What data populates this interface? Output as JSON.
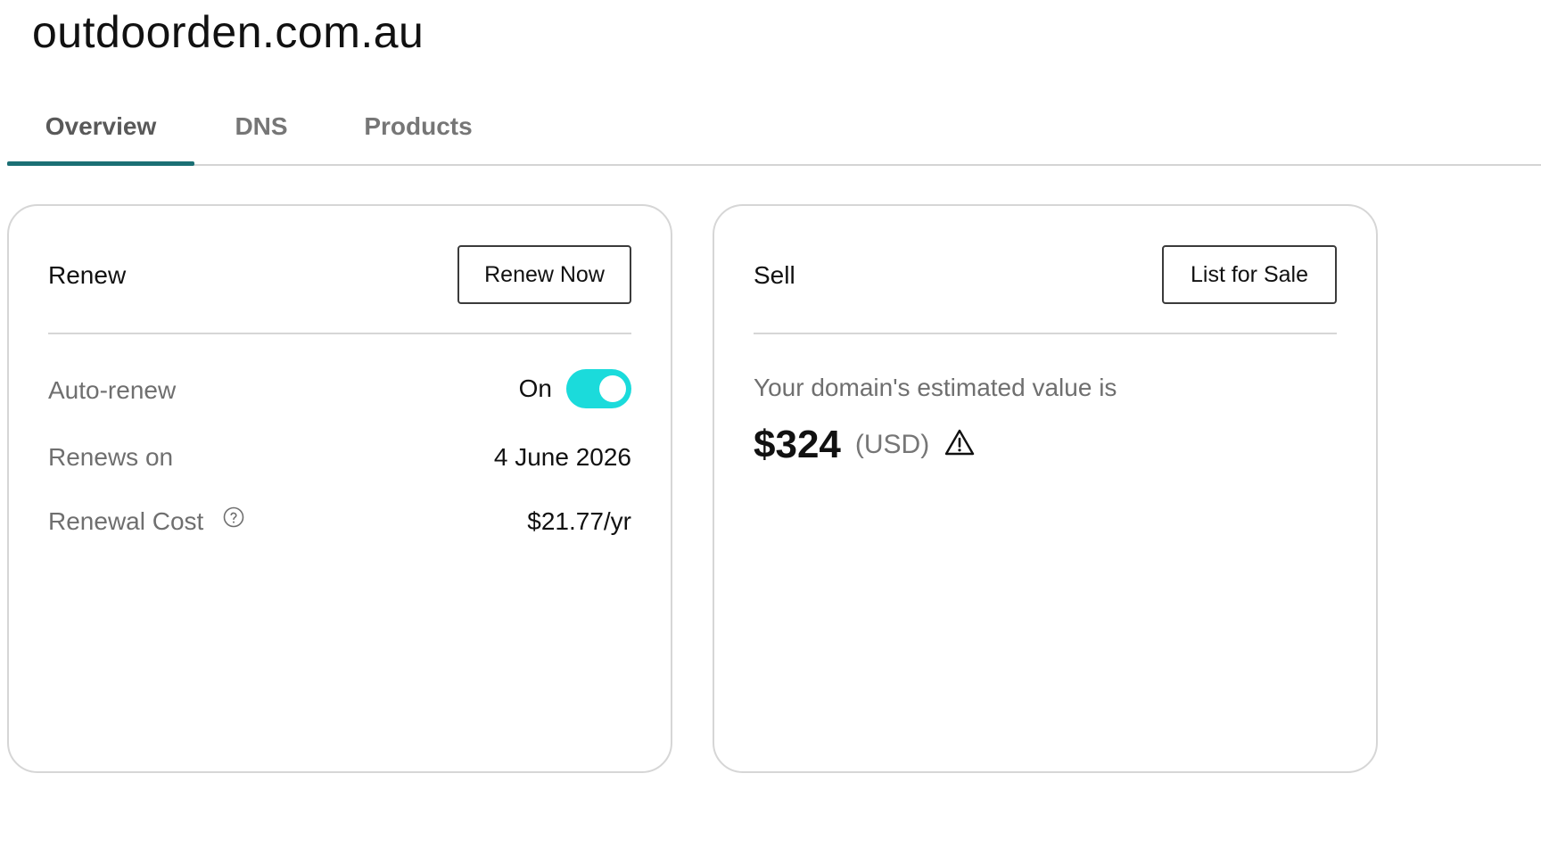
{
  "domain": "outdoorden.com.au",
  "tabs": [
    {
      "label": "Overview",
      "active": true
    },
    {
      "label": "DNS",
      "active": false
    },
    {
      "label": "Products",
      "active": false
    }
  ],
  "renew": {
    "heading": "Renew",
    "button": "Renew Now",
    "auto_renew": {
      "label": "Auto-renew",
      "state_text": "On",
      "enabled": true
    },
    "renews_on": {
      "label": "Renews on",
      "value": "4 June 2026"
    },
    "renewal_cost": {
      "label": "Renewal Cost",
      "value": "$21.77/yr",
      "icon": "help-circle-icon"
    }
  },
  "sell": {
    "heading": "Sell",
    "button": "List for Sale",
    "intro": "Your domain's estimated value is",
    "amount": "$324",
    "currency": "(USD)",
    "icon": "warning-triangle-icon"
  },
  "colors": {
    "tab_underline": "#1b6f74",
    "toggle_on": "#1bdbdb",
    "border": "#d6d6d6"
  }
}
